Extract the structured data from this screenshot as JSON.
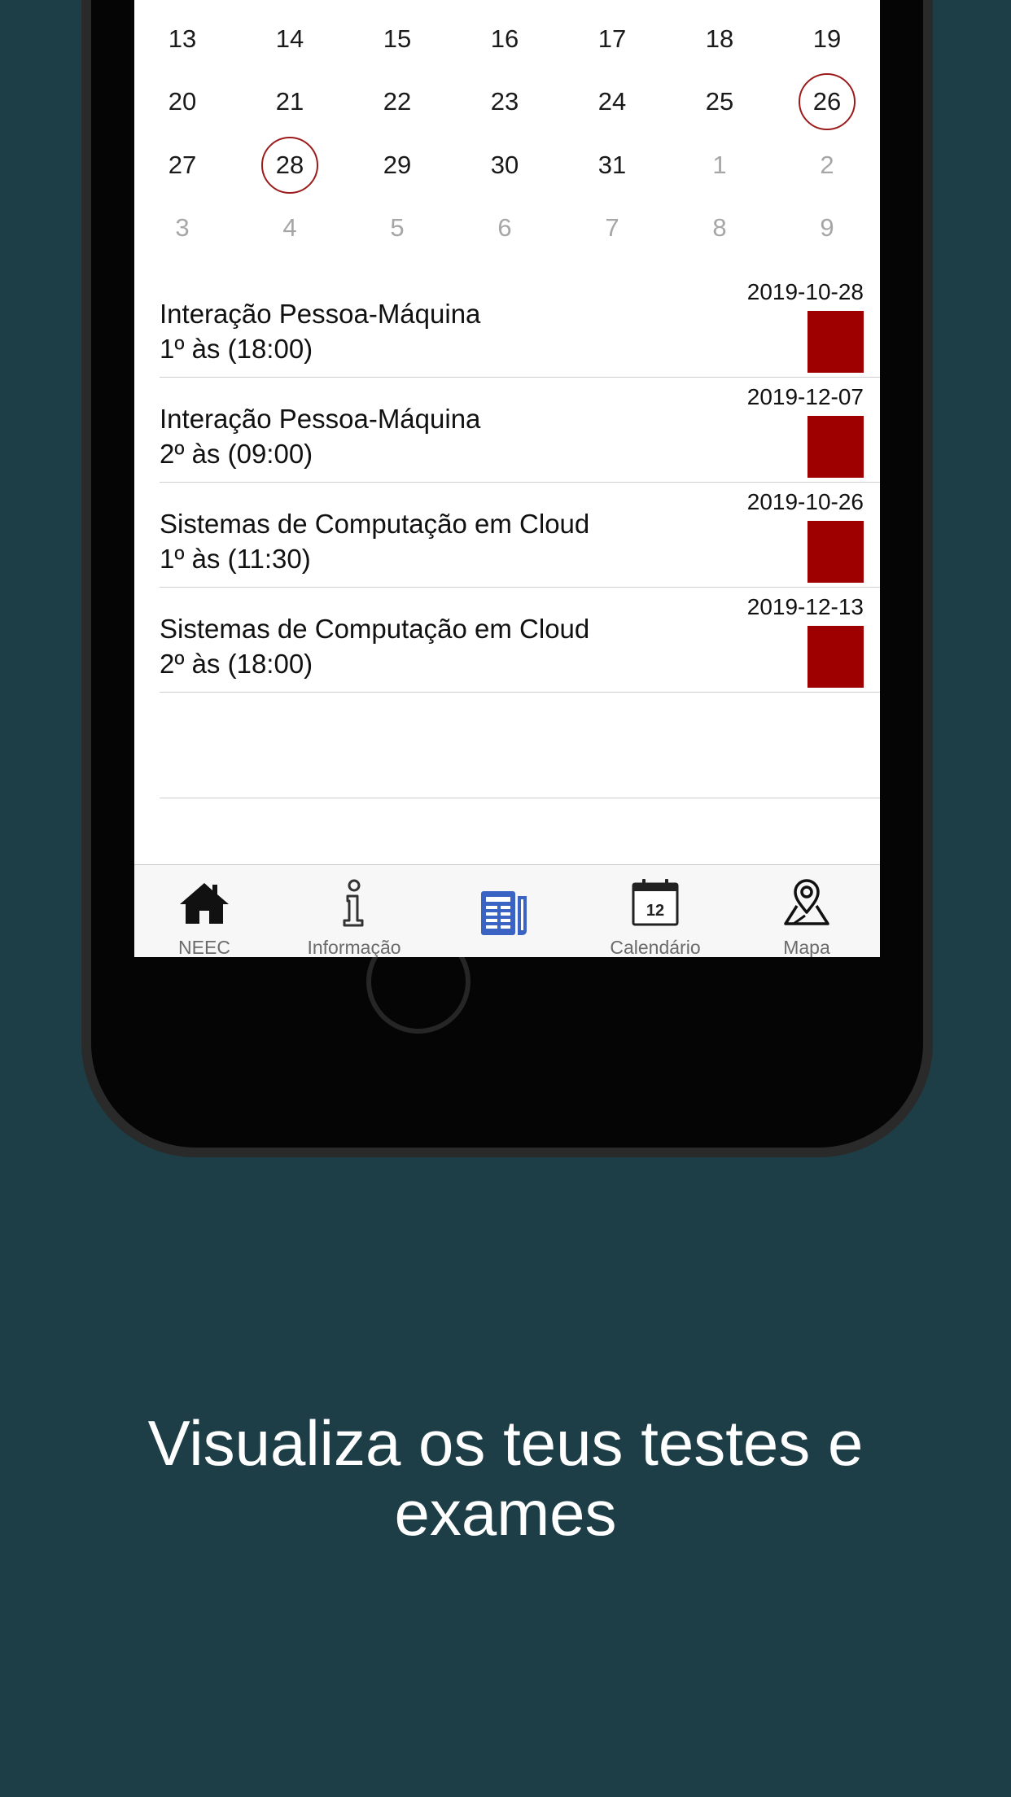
{
  "calendar": {
    "weeks": [
      [
        {
          "d": "13"
        },
        {
          "d": "14"
        },
        {
          "d": "15"
        },
        {
          "d": "16"
        },
        {
          "d": "17"
        },
        {
          "d": "18"
        },
        {
          "d": "19"
        }
      ],
      [
        {
          "d": "20"
        },
        {
          "d": "21"
        },
        {
          "d": "22"
        },
        {
          "d": "23"
        },
        {
          "d": "24"
        },
        {
          "d": "25"
        },
        {
          "d": "26",
          "marked": true
        }
      ],
      [
        {
          "d": "27"
        },
        {
          "d": "28",
          "marked": true
        },
        {
          "d": "29"
        },
        {
          "d": "30"
        },
        {
          "d": "31"
        },
        {
          "d": "1",
          "muted": true
        },
        {
          "d": "2",
          "muted": true
        }
      ],
      [
        {
          "d": "3",
          "muted": true
        },
        {
          "d": "4",
          "muted": true
        },
        {
          "d": "5",
          "muted": true
        },
        {
          "d": "6",
          "muted": true
        },
        {
          "d": "7",
          "muted": true
        },
        {
          "d": "8",
          "muted": true
        },
        {
          "d": "9",
          "muted": true
        }
      ]
    ],
    "marked_color": "#9b1b1b"
  },
  "exams": [
    {
      "title": "Interação Pessoa-Máquina",
      "time": "1º às (18:00)",
      "date": "2019-10-28",
      "color": "#9e0000"
    },
    {
      "title": "Interação Pessoa-Máquina",
      "time": "2º às (09:00)",
      "date": "2019-12-07",
      "color": "#9e0000"
    },
    {
      "title": "Sistemas de Computação em Cloud",
      "time": "1º às (11:30)",
      "date": "2019-10-26",
      "color": "#9e0000"
    },
    {
      "title": "Sistemas de Computação em Cloud",
      "time": "2º às (18:00)",
      "date": "2019-12-13",
      "color": "#9e0000"
    }
  ],
  "tabbar": {
    "active_color": "#3b63c4",
    "tabs": [
      {
        "label": "NEEC",
        "icon": "house-icon"
      },
      {
        "label": "Informação",
        "icon": "info-icon"
      },
      {
        "label": "",
        "icon": "newspaper-icon",
        "active": true
      },
      {
        "label": "Calendário",
        "icon": "calendar-icon",
        "icon_text": "12"
      },
      {
        "label": "Mapa",
        "icon": "map-pin-icon"
      }
    ]
  },
  "headline": {
    "line1": "Visualiza os teus testes e",
    "line2": "exames"
  }
}
